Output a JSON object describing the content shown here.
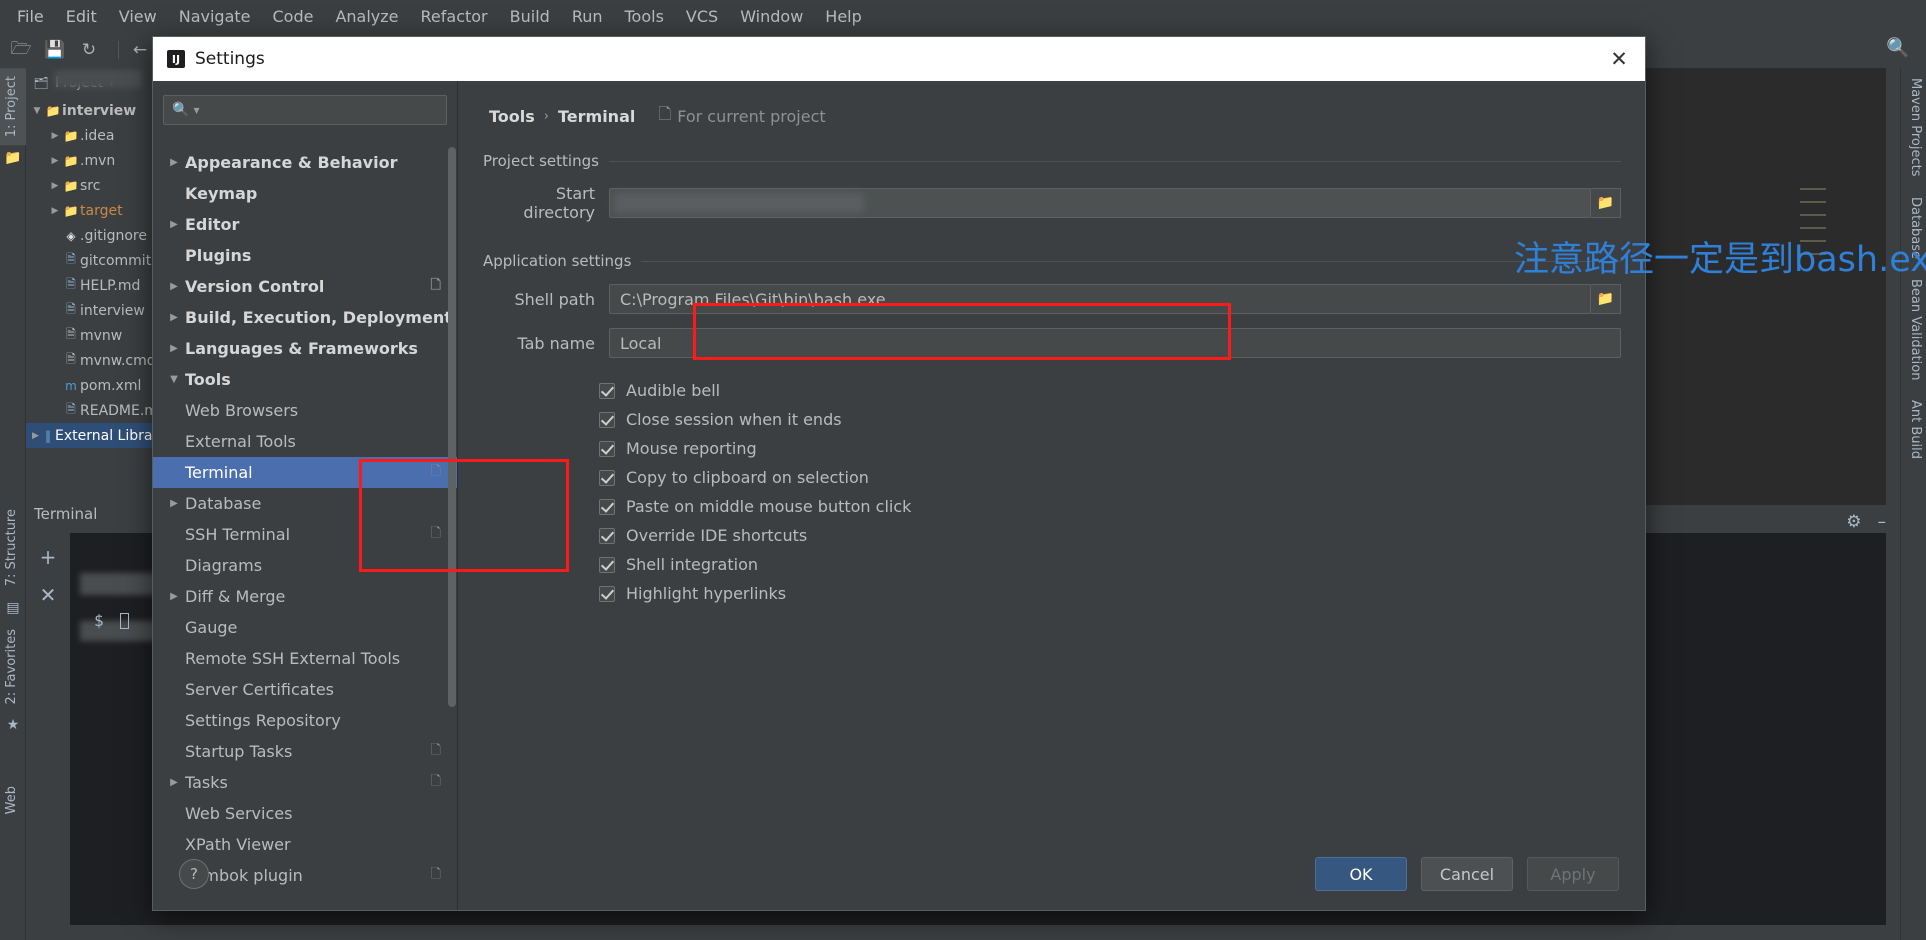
{
  "menubar": {
    "items": [
      "File",
      "Edit",
      "View",
      "Navigate",
      "Code",
      "Analyze",
      "Refactor",
      "Build",
      "Run",
      "Tools",
      "VCS",
      "Window",
      "Help"
    ]
  },
  "toolbar": {
    "icons": [
      "open-folder-icon",
      "save-icon",
      "sync-icon",
      "back-arrow-icon"
    ],
    "search_icon": "search-icon"
  },
  "left_stripe": {
    "project_label": "1: Project",
    "structure_label": "7: Structure",
    "favorites_label": "2: Favorites",
    "web_label": "Web"
  },
  "right_stripe": {
    "maven_label": "Maven Projects",
    "database_label": "Database",
    "bean_label": "Bean Validation",
    "ant_label": "Ant Build"
  },
  "project_panel": {
    "header_label": "Project",
    "tree": [
      {
        "label": "interview",
        "arrow": "down",
        "icon": "module-folder-icon",
        "indent": 0,
        "bold": true,
        "state": "normal"
      },
      {
        "label": ".idea",
        "arrow": "right",
        "icon": "folder-icon",
        "indent": 1,
        "bold": false,
        "state": "normal"
      },
      {
        "label": ".mvn",
        "arrow": "right",
        "icon": "folder-icon",
        "indent": 1,
        "bold": false,
        "state": "normal"
      },
      {
        "label": "src",
        "arrow": "right",
        "icon": "folder-icon",
        "indent": 1,
        "bold": false,
        "state": "normal"
      },
      {
        "label": "target",
        "arrow": "right",
        "icon": "folder-excluded-icon",
        "indent": 1,
        "bold": false,
        "state": "excluded"
      },
      {
        "label": ".gitignore",
        "arrow": "none",
        "icon": "git-file-icon",
        "indent": 1,
        "bold": false,
        "state": "normal"
      },
      {
        "label": "gitcommit",
        "arrow": "none",
        "icon": "markdown-file-icon",
        "indent": 1,
        "bold": false,
        "state": "normal"
      },
      {
        "label": "HELP.md",
        "arrow": "none",
        "icon": "markdown-file-icon",
        "indent": 1,
        "bold": false,
        "state": "normal"
      },
      {
        "label": "interview",
        "arrow": "none",
        "icon": "iml-file-icon",
        "indent": 1,
        "bold": false,
        "state": "normal"
      },
      {
        "label": "mvnw",
        "arrow": "none",
        "icon": "text-file-icon",
        "indent": 1,
        "bold": false,
        "state": "normal"
      },
      {
        "label": "mvnw.cmd",
        "arrow": "none",
        "icon": "text-file-icon",
        "indent": 1,
        "bold": false,
        "state": "normal"
      },
      {
        "label": "pom.xml",
        "arrow": "none",
        "icon": "maven-file-icon",
        "indent": 1,
        "bold": false,
        "state": "normal"
      },
      {
        "label": "README.md",
        "arrow": "none",
        "icon": "markdown-file-icon",
        "indent": 1,
        "bold": false,
        "state": "normal"
      },
      {
        "label": "External Libraries",
        "arrow": "right",
        "icon": "library-icon",
        "indent": 0,
        "bold": false,
        "state": "selected"
      }
    ]
  },
  "terminal_panel": {
    "title": "Terminal",
    "add_icon": "plus-icon",
    "close_icon": "close-icon",
    "prompt": "$",
    "settings_icon": "gear-icon",
    "minimize_icon": "minimize-icon"
  },
  "dialog": {
    "title": "Settings",
    "logo_icon": "intellij-logo-icon",
    "close_icon": "close-icon",
    "search": {
      "placeholder": "",
      "value": "",
      "icon": "search-icon",
      "caret": "caret-down-icon"
    },
    "tree": [
      {
        "label": "Appearance & Behavior",
        "arrow": "right",
        "level": 0,
        "bold": true,
        "selected": false,
        "copy": false
      },
      {
        "label": "Keymap",
        "arrow": "none",
        "level": 0,
        "bold": true,
        "selected": false,
        "copy": false
      },
      {
        "label": "Editor",
        "arrow": "right",
        "level": 0,
        "bold": true,
        "selected": false,
        "copy": false
      },
      {
        "label": "Plugins",
        "arrow": "none",
        "level": 0,
        "bold": true,
        "selected": false,
        "copy": false
      },
      {
        "label": "Version Control",
        "arrow": "right",
        "level": 0,
        "bold": true,
        "selected": false,
        "copy": true
      },
      {
        "label": "Build, Execution, Deployment",
        "arrow": "right",
        "level": 0,
        "bold": true,
        "selected": false,
        "copy": false
      },
      {
        "label": "Languages & Frameworks",
        "arrow": "right",
        "level": 0,
        "bold": true,
        "selected": false,
        "copy": false
      },
      {
        "label": "Tools",
        "arrow": "down",
        "level": 0,
        "bold": true,
        "selected": false,
        "copy": false
      },
      {
        "label": "Web Browsers",
        "arrow": "none",
        "level": 1,
        "bold": false,
        "selected": false,
        "copy": false
      },
      {
        "label": "External Tools",
        "arrow": "none",
        "level": 1,
        "bold": false,
        "selected": false,
        "copy": false
      },
      {
        "label": "Terminal",
        "arrow": "none",
        "level": 1,
        "bold": false,
        "selected": true,
        "copy": true
      },
      {
        "label": "Database",
        "arrow": "right",
        "level": 1,
        "bold": false,
        "selected": false,
        "copy": false
      },
      {
        "label": "SSH Terminal",
        "arrow": "none",
        "level": 1,
        "bold": false,
        "selected": false,
        "copy": true
      },
      {
        "label": "Diagrams",
        "arrow": "none",
        "level": 1,
        "bold": false,
        "selected": false,
        "copy": false
      },
      {
        "label": "Diff & Merge",
        "arrow": "right",
        "level": 1,
        "bold": false,
        "selected": false,
        "copy": false
      },
      {
        "label": "Gauge",
        "arrow": "none",
        "level": 1,
        "bold": false,
        "selected": false,
        "copy": false
      },
      {
        "label": "Remote SSH External Tools",
        "arrow": "none",
        "level": 1,
        "bold": false,
        "selected": false,
        "copy": false
      },
      {
        "label": "Server Certificates",
        "arrow": "none",
        "level": 1,
        "bold": false,
        "selected": false,
        "copy": false
      },
      {
        "label": "Settings Repository",
        "arrow": "none",
        "level": 1,
        "bold": false,
        "selected": false,
        "copy": false
      },
      {
        "label": "Startup Tasks",
        "arrow": "none",
        "level": 1,
        "bold": false,
        "selected": false,
        "copy": true
      },
      {
        "label": "Tasks",
        "arrow": "right",
        "level": 1,
        "bold": false,
        "selected": false,
        "copy": true
      },
      {
        "label": "Web Services",
        "arrow": "none",
        "level": 1,
        "bold": false,
        "selected": false,
        "copy": false
      },
      {
        "label": "XPath Viewer",
        "arrow": "none",
        "level": 1,
        "bold": false,
        "selected": false,
        "copy": false
      },
      {
        "label": "Lombok plugin",
        "arrow": "none",
        "level": 1,
        "bold": false,
        "selected": false,
        "copy": true
      }
    ],
    "breadcrumb": {
      "parent": "Tools",
      "separator": "›",
      "current": "Terminal",
      "scope_label": "For current project",
      "scope_icon": "copy-icon"
    },
    "project_settings": {
      "group_title": "Project settings",
      "start_directory_label": "Start directory",
      "start_directory_value": "",
      "browse_icon": "folder-browse-icon"
    },
    "application_settings": {
      "group_title": "Application settings",
      "shell_path_label": "Shell path",
      "shell_path_value": "C:\\Program Files\\Git\\bin\\bash.exe",
      "tab_name_label": "Tab name",
      "tab_name_value": "Local",
      "browse_icon": "folder-browse-icon",
      "checkboxes": [
        {
          "label": "Audible bell",
          "checked": true
        },
        {
          "label": "Close session when it ends",
          "checked": true
        },
        {
          "label": "Mouse reporting",
          "checked": true
        },
        {
          "label": "Copy to clipboard on selection",
          "checked": true
        },
        {
          "label": "Paste on middle mouse button click",
          "checked": true
        },
        {
          "label": "Override IDE shortcuts",
          "checked": true
        },
        {
          "label": "Shell integration",
          "checked": true
        },
        {
          "label": "Highlight hyperlinks",
          "checked": true
        }
      ]
    },
    "annotation": {
      "text": "注意路径一定是到bash.exe",
      "color": "#2f80d8"
    },
    "highlight_color": "#ff1a1a",
    "footer": {
      "help_label": "?",
      "ok_label": "OK",
      "cancel_label": "Cancel",
      "apply_label": "Apply"
    }
  }
}
